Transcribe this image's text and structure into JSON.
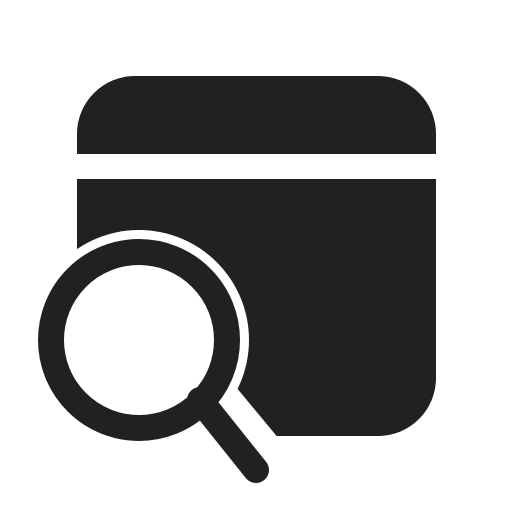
{
  "icon": {
    "name": "app-window-search-icon",
    "components": [
      "window-frame",
      "title-bar-divider",
      "magnifier-lens",
      "magnifier-handle"
    ]
  },
  "colors": {
    "foreground": "#212121",
    "background": "#ffffff"
  }
}
